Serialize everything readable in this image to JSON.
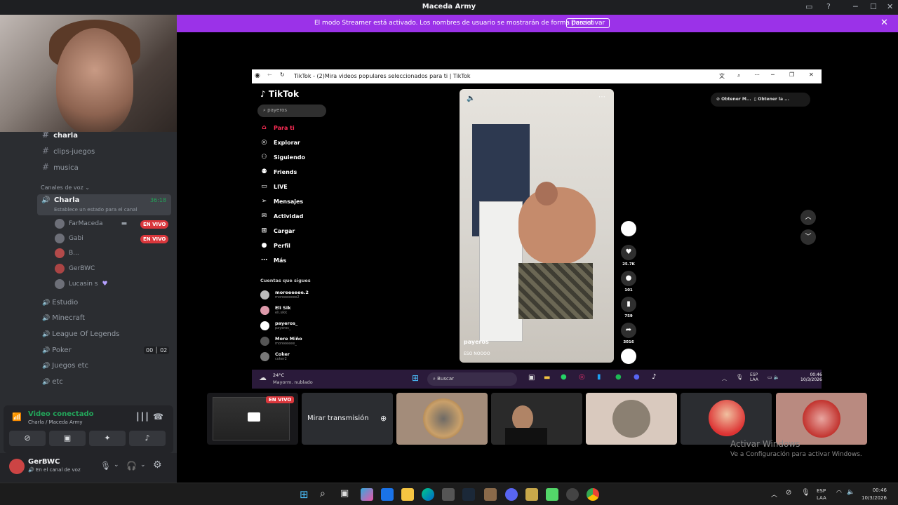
{
  "window": {
    "title": "Maceda Army"
  },
  "banner": {
    "message": "El modo Streamer está activado. Los nombres de usuario se mostrarán de forma parcial.",
    "button": "Desactivar"
  },
  "sidebar": {
    "text_channels": [
      "charla",
      "clips-juegos",
      "musica"
    ],
    "voice_header": "Canales de voz",
    "active_channel": {
      "name": "Charla",
      "status_hint": "Establece un estado para el canal",
      "timer": "36:18"
    },
    "users": [
      {
        "name": "FarMaceda",
        "live": "EN VIVO"
      },
      {
        "name": "Gabi",
        "live": "EN VIVO"
      },
      {
        "name": "B...",
        "live": ""
      },
      {
        "name": "GerBWC",
        "live": ""
      },
      {
        "name": "Lucasin s",
        "live": ""
      }
    ],
    "voice_channels": [
      "Estudio",
      "Minecraft",
      "League Of Legends",
      "Poker",
      "Juegos etc",
      "etc"
    ],
    "poker_counts": [
      "00",
      "02"
    ]
  },
  "voice_panel": {
    "status": "Video conectado",
    "location": "Charla / Maceda Army"
  },
  "user_bar": {
    "name": "GerBWC",
    "status": "En el canal de voz"
  },
  "tiktok": {
    "tab_title": "TikTok - (2)Mira videos populares seleccionados para ti | TikTok",
    "logo": "TikTok",
    "search_value": "payeros",
    "nav": [
      "Para ti",
      "Explorar",
      "Siguiendo",
      "Friends",
      "LIVE",
      "Mensajes",
      "Actividad",
      "Cargar",
      "Perfil",
      "Más"
    ],
    "following_header": "Cuentas que sigues",
    "accounts": [
      {
        "name": "moreeeeee.2",
        "sub": "moreeeeeee2"
      },
      {
        "name": "Eli Sik",
        "sub": "eli.sikk"
      },
      {
        "name": "payeros_",
        "sub": "payeros_"
      },
      {
        "name": "More Miño",
        "sub": "moreeeeee_"
      },
      {
        "name": "Coker",
        "sub": "coker2"
      }
    ],
    "top_buttons": [
      "Obtener M...",
      "Obtener la ..."
    ],
    "video": {
      "username": "payeros",
      "caption": "ESO NOOOO"
    },
    "counts": [
      "25.7K",
      "101",
      "759",
      "3016"
    ]
  },
  "inner_taskbar": {
    "weather_temp": "24°C",
    "weather_desc": "Mayorm. nublado",
    "search": "Buscar",
    "lang1": "ESP",
    "lang2": "LAA",
    "time": "00:46",
    "date": "10/3/2026"
  },
  "tiles": {
    "live_badge": "EN VIVO",
    "watch_button": "Mirar transmisión"
  },
  "activation": {
    "title": "Activar Windows",
    "subtitle": "Ve a Configuración para activar Windows."
  },
  "taskbar": {
    "lang1": "ESP",
    "lang2": "LAA",
    "time": "00:46",
    "date": "10/3/2026"
  }
}
